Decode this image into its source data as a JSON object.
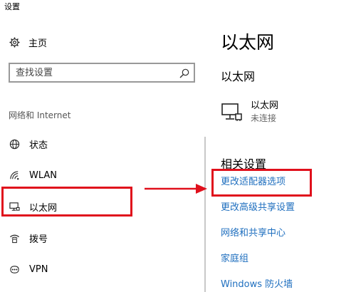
{
  "window": {
    "title": "设置"
  },
  "sidebar": {
    "home_label": "主页",
    "search_placeholder": "查找设置",
    "section_label": "网络和 Internet",
    "items": [
      {
        "label": "状态",
        "icon": "globe-icon"
      },
      {
        "label": "WLAN",
        "icon": "wifi-icon"
      },
      {
        "label": "以太网",
        "icon": "ethernet-icon",
        "selected": true
      },
      {
        "label": "拨号",
        "icon": "dialup-icon"
      },
      {
        "label": "VPN",
        "icon": "vpn-icon"
      }
    ]
  },
  "main": {
    "title": "以太网",
    "subtitle": "以太网",
    "connection": {
      "name": "以太网",
      "status": "未连接",
      "icon": "monitor-network-icon"
    },
    "related_title": "相关设置",
    "links": [
      "更改适配器选项",
      "更改高级共享设置",
      "网络和共享中心",
      "家庭组",
      "Windows 防火墙"
    ]
  },
  "colors": {
    "accent_link": "#1f6fbf",
    "annotation_red": "#e0101c"
  }
}
